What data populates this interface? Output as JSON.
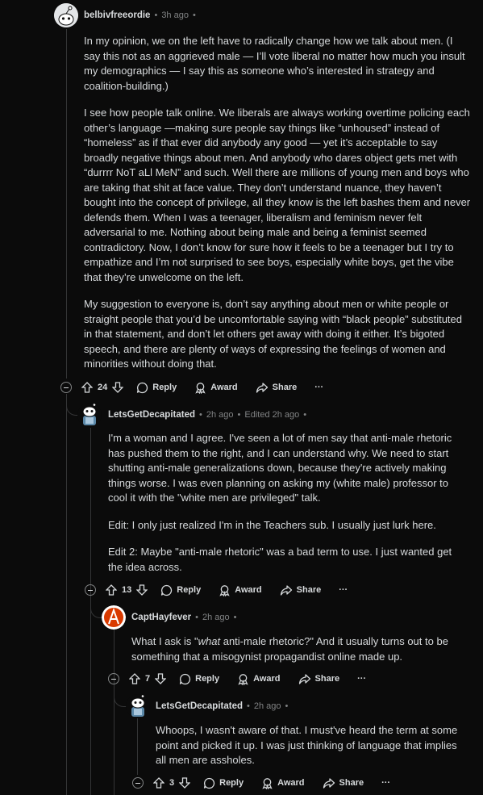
{
  "comments": [
    {
      "username": "belbivfreeordie",
      "time": "3h ago",
      "paragraphs": [
        "In my opinion, we on the left have to radically change how we talk about men. (I say this not as an aggrieved male — I’ll vote liberal no matter how much you insult my demographics — I say this as someone who’s interested in strategy and coalition-building.)",
        "I see how people talk online. We liberals are always working overtime policing each other’s language —making sure people say things like “unhoused” instead of “homeless” as if that ever did anybody any good — yet it’s acceptable to say broadly negative things about men. And anybody who dares object gets met with “durrrr NoT aLl MeN” and such. Well there are millions of young men and boys who are taking that shit at face value. They don’t understand nuance, they haven’t bought into the concept of privilege, all they know is the left bashes them and never defends them. When I was a teenager, liberalism and feminism never felt adversarial to me. Nothing about being male and being a feminist seemed contradictory. Now, I don’t know for sure how it feels to be a teenager but I try to empathize and I’m not surprised to see boys, especially white boys, get the vibe that they’re unwelcome on the left.",
        "My suggestion to everyone is, don’t say anything about men or white people or straight people that you’d be uncomfortable saying with “black people” substituted in that statement, and don’t let others get away with doing it either. It’s bigoted speech, and there are plenty of ways of expressing the feelings of women and minorities without doing that."
      ],
      "votes": "24"
    },
    {
      "username": "LetsGetDecapitated",
      "time": "2h ago",
      "edited": "Edited 2h ago",
      "paragraphs": [
        "I'm a woman and I agree. I've seen a lot of men say that anti-male rhetoric has pushed them to the right, and I can understand why. We need to start shutting anti-male generalizations down, because they're actively making things worse. I was even planning on asking my (white male) professor to cool it with the \"white men are privileged\" talk.",
        "Edit: I only just realized I'm in the Teachers sub. I usually just lurk here.",
        "Edit 2: Maybe \"anti-male rhetoric\" was a bad term to use. I just wanted get the idea across."
      ],
      "votes": "13"
    },
    {
      "username": "CaptHayfever",
      "time": "2h ago",
      "text_before": "What I ask is \"",
      "text_em": "what",
      "text_after": " anti-male rhetoric?\" And it usually turns out to be something that a misogynist propagandist online made up.",
      "votes": "7"
    },
    {
      "username": "LetsGetDecapitated",
      "time": "2h ago",
      "paragraphs": [
        "Whoops, I wasn't aware of that. I must've heard the term at some point and picked it up. I was just thinking of language that implies all men are assholes."
      ],
      "votes": "3"
    }
  ],
  "actions": {
    "reply": "Reply",
    "award": "Award",
    "share": "Share",
    "more": "···"
  },
  "separator": "•",
  "icons": [
    "upvote-icon",
    "downvote-icon",
    "reply-bubble-icon",
    "award-icon",
    "share-arrow-icon",
    "collapse-icon"
  ],
  "colors": {
    "background": "#0b0b0b",
    "text": "#d7dadc",
    "muted": "#818384",
    "thread_line": "#343536",
    "red_avatar": "#d93a00"
  }
}
